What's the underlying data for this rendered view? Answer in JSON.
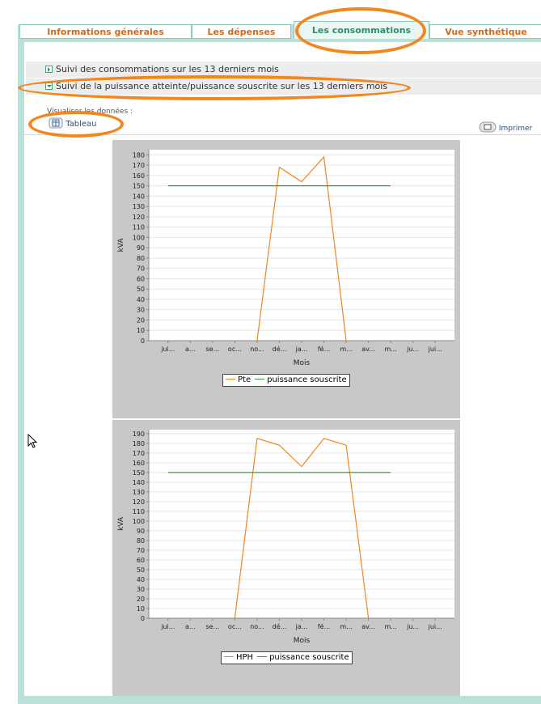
{
  "tabs": [
    {
      "label": "Informations générales",
      "active": false
    },
    {
      "label": "Les dépenses",
      "active": false
    },
    {
      "label": "Les consommations",
      "active": true
    },
    {
      "label": "Vue synthétique",
      "active": false
    }
  ],
  "sections": [
    {
      "label": "Suivi des consommations sur les 13 derniers mois",
      "expanded": false
    },
    {
      "label": "Suivi de la puissance atteinte/puissance souscrite sur les 13 derniers mois",
      "expanded": true
    }
  ],
  "view_label": "Visualiser les données :",
  "buttons": {
    "table_label": "Tableau",
    "print_label": "Imprimer"
  },
  "icons": [
    "expand-arrow-icon",
    "collapse-arrow-icon",
    "table-icon",
    "print-icon",
    "mouse-cursor-icon"
  ],
  "colors": {
    "accent_orange": "#f2861f",
    "tab_text": "#d2691e",
    "active_tab_text": "#2d8e6f",
    "frame": "#b9e0d9",
    "series_actual": "#f2861f",
    "series_subscribed": "#3a9a3a"
  },
  "chart_data": [
    {
      "type": "line",
      "xlabel": "Mois",
      "ylabel": "kVA",
      "categories": [
        "jui...",
        "a...",
        "se...",
        "oc...",
        "no...",
        "dé...",
        "ja...",
        "fé...",
        "m...",
        "av...",
        "m...",
        "ju...",
        "jui..."
      ],
      "ylim": [
        0,
        185
      ],
      "yticks": [
        0,
        10,
        20,
        30,
        40,
        50,
        60,
        70,
        80,
        90,
        100,
        110,
        120,
        130,
        140,
        150,
        160,
        170,
        180
      ],
      "series": [
        {
          "name": "Pte",
          "color": "#f2861f",
          "x": [
            4,
            5,
            6,
            7,
            8
          ],
          "y": [
            0,
            168,
            154,
            178,
            0
          ]
        },
        {
          "name": "puissance souscrite",
          "color": "#3a9a3a",
          "x": [
            0,
            10
          ],
          "y": [
            150,
            150
          ]
        }
      ],
      "legend_position": "bottom"
    },
    {
      "type": "line",
      "xlabel": "Mois",
      "ylabel": "kVA",
      "categories": [
        "jui...",
        "a...",
        "se...",
        "oc...",
        "no...",
        "dé...",
        "ja...",
        "fé...",
        "m...",
        "av...",
        "m...",
        "ju...",
        "jui..."
      ],
      "ylim": [
        0,
        194
      ],
      "yticks": [
        0,
        10,
        20,
        30,
        40,
        50,
        60,
        70,
        80,
        90,
        100,
        110,
        120,
        130,
        140,
        150,
        160,
        170,
        180,
        190
      ],
      "series": [
        {
          "name": "HPH",
          "color": "#f2861f",
          "x": [
            3,
            4,
            5,
            6,
            7,
            8,
            9
          ],
          "y": [
            0,
            185,
            178,
            156,
            185,
            178,
            0
          ]
        },
        {
          "name": "puissance souscrite",
          "color": "#3a9a3a",
          "x": [
            0,
            10
          ],
          "y": [
            150,
            150
          ]
        }
      ],
      "legend_position": "bottom"
    }
  ]
}
